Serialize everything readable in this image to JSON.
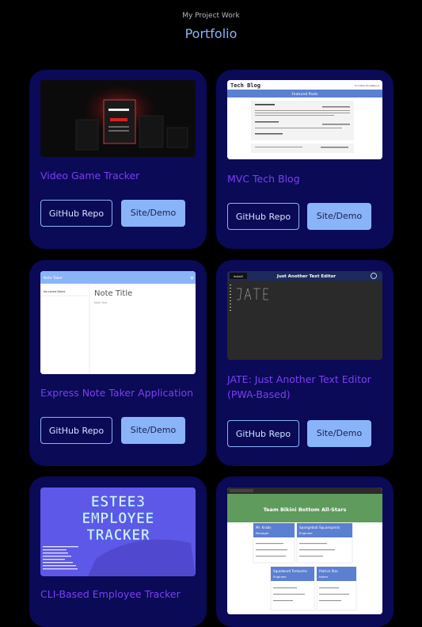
{
  "header": {
    "eyebrow": "My Project Work",
    "title": "Portfolio"
  },
  "colors": {
    "background": "#000000",
    "card": "#0a0a57",
    "accent": "#8ab4f8",
    "project_title": "#7b3ff2"
  },
  "projects": [
    {
      "title": "Video Game Tracker",
      "repo_label": "GitHub Repo",
      "demo_label": "Site/Demo"
    },
    {
      "title": "MVC Tech Blog",
      "repo_label": "GitHub Repo",
      "demo_label": "Site/Demo",
      "preview": {
        "brand": "Tech Blog",
        "nav": [
          "Home",
          "Dashboard",
          "Logout"
        ],
        "heading": "Featured Posts"
      }
    },
    {
      "title": "Express Note Taker Application",
      "repo_label": "GitHub Repo",
      "demo_label": "Site/Demo",
      "preview": {
        "app": "Note Taker",
        "empty": "No saved Notes",
        "note_title": "Note Title",
        "note_text": "Note Text"
      }
    },
    {
      "title": "JATE: Just Another Text Editor (PWA-Based)",
      "repo_label": "GitHub Repo",
      "demo_label": "Site/Demo",
      "preview": {
        "install": "Install!",
        "heading": "Just Another Text Editor"
      }
    },
    {
      "title": "CLI-Based Employee Tracker",
      "preview": {
        "line1": "ESTEE3",
        "line2": "EMPLOYEE",
        "line3": "TRACKER"
      }
    },
    {
      "title": "",
      "preview": {
        "heading": "Team Bikini Bottom All-Stars",
        "members": [
          {
            "name": "Mr. Krabs",
            "role": "Manager"
          },
          {
            "name": "Spongebob Squarepants",
            "role": "Engineer"
          },
          {
            "name": "Squidward Tentacles",
            "role": "Engineer"
          },
          {
            "name": "Patrick Star",
            "role": "Intern"
          }
        ]
      }
    }
  ]
}
